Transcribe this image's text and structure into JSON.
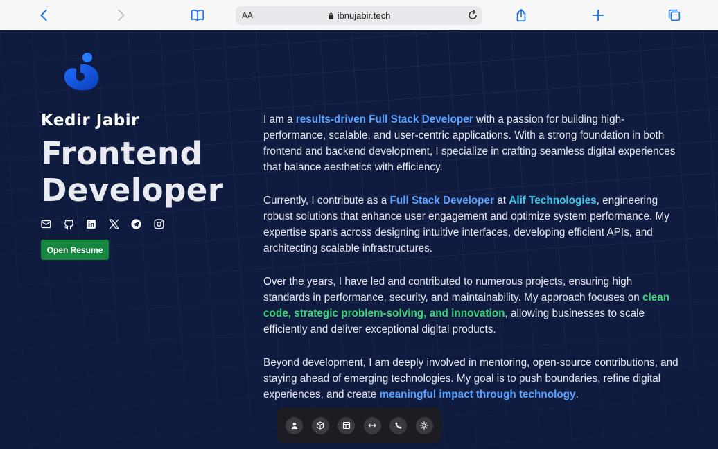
{
  "browser": {
    "text_size_label": "AA",
    "url": "ibnujabir.tech"
  },
  "profile": {
    "name": "Kedir Jabir",
    "role_line1": "Frontend",
    "role_line2": "Developer",
    "resume_label": "Open Resume"
  },
  "socials": [
    "mail-icon",
    "github-icon",
    "linkedin-icon",
    "x-icon",
    "telegram-icon",
    "instagram-icon"
  ],
  "bio": {
    "p1": [
      "I am a ",
      "results-driven Full Stack Developer",
      " with a passion for building high-performance, scalable, and user-centric applications. With a strong foundation in both frontend and backend development, I specialize in crafting seamless digital experiences that balance aesthetics with efficiency."
    ],
    "p2": [
      "Currently, I contribute as a ",
      "Full Stack Developer",
      " at ",
      "Alif Technologies",
      ", engineering robust solutions that enhance user engagement and optimize system performance. My expertise spans across designing intuitive interfaces, developing efficient APIs, and architecting scalable infrastructures."
    ],
    "p3": [
      "Over the years, I have led and contributed to numerous projects, ensuring high standards in performance, security, and maintainability. My approach focuses on ",
      "clean code, strategic problem-solving, and innovation",
      ", allowing businesses to scale efficiently and deliver exceptional digital products."
    ],
    "p4": [
      "Beyond development, I am deeply involved in mentoring, open-source contributions, and staying ahead of emerging technologies. My goal is to push boundaries, refine digital experiences, and create ",
      "meaningful impact through technology",
      "."
    ]
  },
  "dock": [
    "user-icon",
    "box-icon",
    "layout-icon",
    "code-arrows-icon",
    "phone-icon",
    "sun-icon"
  ],
  "colors": {
    "background": "#0f1c3f",
    "accent_blue": "#5aa2ff",
    "accent_cyan": "#3fc7ee",
    "accent_green": "#3fd27a",
    "button_green": "#16873e"
  }
}
